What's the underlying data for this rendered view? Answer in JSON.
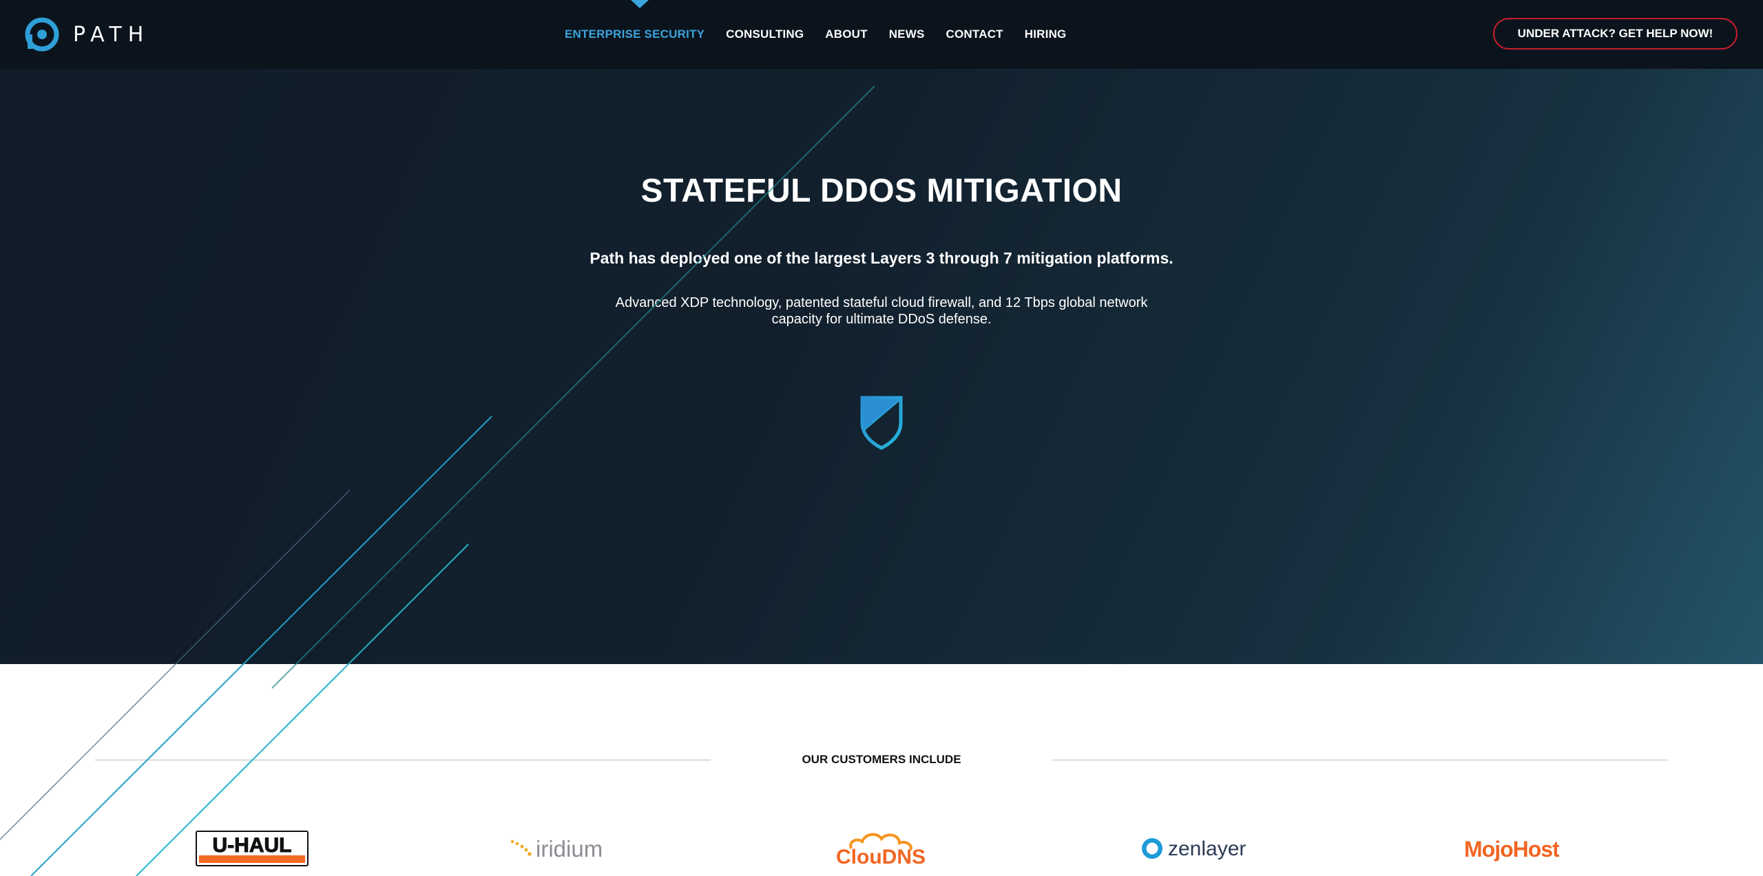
{
  "brand": {
    "name": "PATH",
    "accent": "#3ba4dc",
    "alert": "#c81e2d"
  },
  "nav": {
    "items": [
      {
        "label": "ENTERPRISE SECURITY",
        "active": true
      },
      {
        "label": "CONSULTING",
        "active": false
      },
      {
        "label": "ABOUT",
        "active": false
      },
      {
        "label": "NEWS",
        "active": false
      },
      {
        "label": "CONTACT",
        "active": false
      },
      {
        "label": "HIRING",
        "active": false
      }
    ],
    "help_button": "UNDER ATTACK? GET HELP NOW!"
  },
  "hero": {
    "title": "STATEFUL DDOS MITIGATION",
    "subtitle": "Path has deployed one of the largest Layers 3 through 7 mitigation platforms.",
    "description": "Advanced XDP technology, patented stateful cloud firewall, and 12 Tbps global network capacity for ultimate DDoS defense.",
    "icon": "shield-icon"
  },
  "customers": {
    "title": "OUR CUSTOMERS INCLUDE",
    "logos": [
      {
        "name": "U-HAUL",
        "icon": "uhaul-logo"
      },
      {
        "name": "iridium",
        "icon": "iridium-logo"
      },
      {
        "name": "ClouDNS",
        "icon": "cloudns-logo"
      },
      {
        "name": "zenlayer",
        "icon": "zenlayer-logo"
      },
      {
        "name": "MojoHost",
        "icon": "mojohost-logo"
      }
    ]
  }
}
